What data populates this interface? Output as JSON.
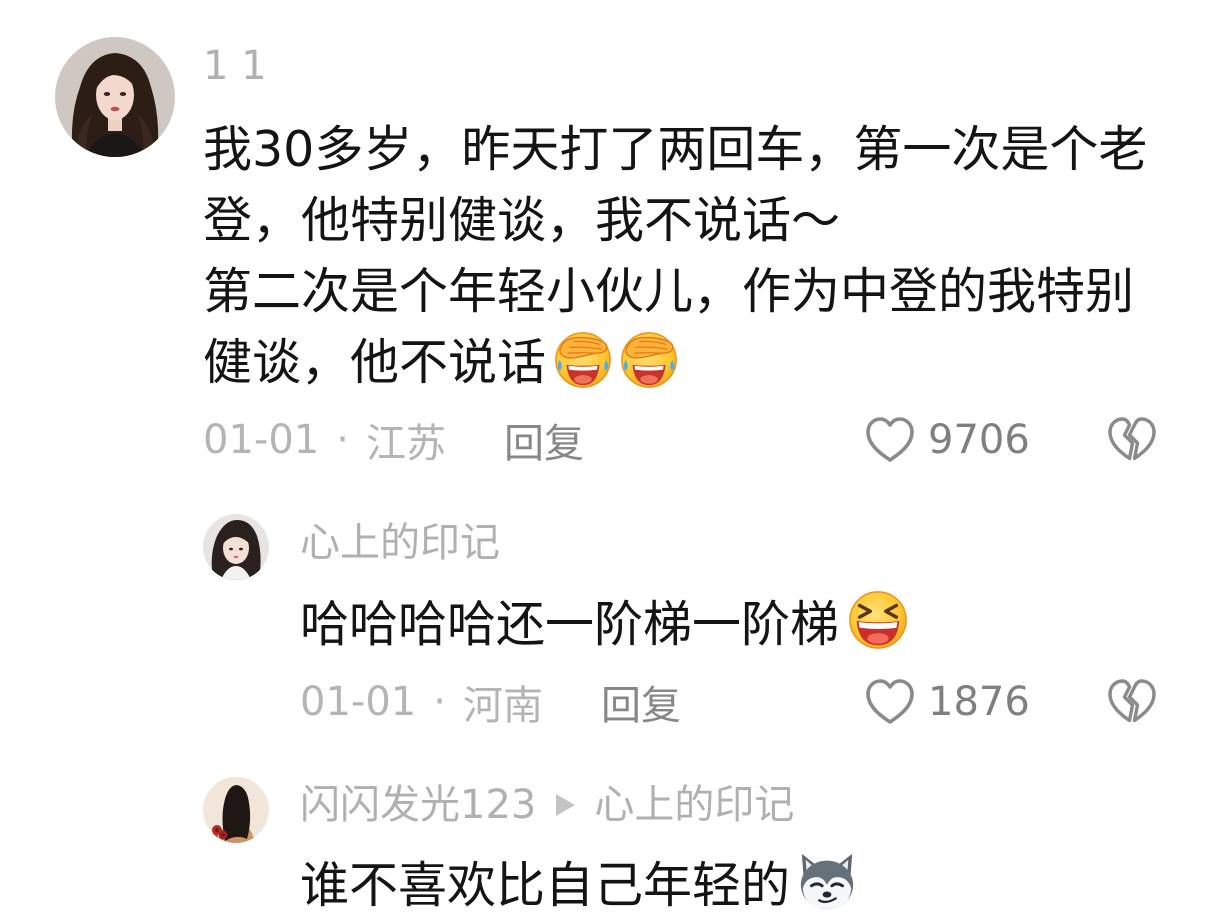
{
  "colors": {
    "background": "#ffffff",
    "text": "#141414",
    "username": "#b0b0b0",
    "meta": "#b4b4b4",
    "action": "#878787",
    "like_count": "#7f7f7f",
    "icon": "#8a8a8a",
    "reply_arrow": "#c4c4c4"
  },
  "ui": {
    "reply_label": "回复",
    "meta_separator": "·",
    "like_icon": "heart-outline-icon",
    "dislike_icon": "broken-heart-icon",
    "reply_to_icon": "play-triangle-icon"
  },
  "comments": [
    {
      "username": "1 1",
      "lines": [
        "我30多岁，昨天打了两回车，第一次是个老",
        "登，他特别健谈，我不说话～",
        "第二次是个年轻小伙儿，作为中登的我特别",
        "健谈，他不说话"
      ],
      "emojis": [
        "cover-face-laugh-emoji",
        "cover-face-laugh-emoji"
      ],
      "date": "01-01",
      "location": "江苏",
      "likes": "9706",
      "replies": [
        {
          "username": "心上的印记",
          "text": "哈哈哈哈还一阶梯一阶梯",
          "emojis": [
            "big-laugh-emoji"
          ],
          "date": "01-01",
          "location": "河南",
          "likes": "1876"
        },
        {
          "username": "闪闪发光123",
          "reply_to": "心上的印记",
          "text": "谁不喜欢比自己年轻的",
          "emojis": [
            "husky-emoji"
          ]
        }
      ]
    }
  ]
}
